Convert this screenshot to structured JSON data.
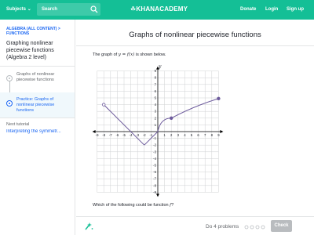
{
  "header": {
    "subjects_label": "Subjects",
    "search_placeholder": "Search",
    "logo_text": "KHANACADEMY",
    "nav": [
      "Donate",
      "Login",
      "Sign up"
    ]
  },
  "sidebar": {
    "breadcrumb": "ALGEBRA (ALL CONTENT) > FUNCTIONS",
    "title": "Graphing nonlinear piecewise functions (Algebra 2 level)",
    "items": [
      {
        "label": "Graphs of nonlinear piecewise functions",
        "active": false
      },
      {
        "label": "Practice: Graphs of nonlinear piecewise functions",
        "active": true
      }
    ],
    "next_label": "Next tutorial",
    "next_link": "Interpreting the symmetr..."
  },
  "main": {
    "title": "Graphs of nonlinear piecewise functions",
    "prompt_prefix": "The graph of",
    "prompt_eq": "y = f(x)",
    "prompt_suffix": "is shown below.",
    "question_prefix": "Which of the following could be function",
    "question_var": "f",
    "question_suffix": "?"
  },
  "graph": {
    "x_axis_label": "x",
    "y_axis_label": "y",
    "x_range": [
      -9,
      9
    ],
    "y_range": [
      -9,
      9
    ],
    "x_ticks": [
      "-9",
      "-8",
      "-7",
      "-6",
      "-5",
      "-4",
      "-3",
      "-2",
      "-1",
      "1",
      "2",
      "3",
      "4",
      "5",
      "6",
      "7",
      "8",
      "9"
    ],
    "y_ticks": [
      "9",
      "8",
      "7",
      "6",
      "5",
      "4",
      "3",
      "2",
      "1",
      "-1",
      "-2",
      "-3",
      "-4",
      "-5",
      "-6",
      "-7",
      "-8",
      "-9"
    ],
    "curve_color": "#6d5b9c",
    "segments": {
      "linear_down": {
        "from": [
          -8,
          4
        ],
        "to": [
          -2,
          -2
        ]
      },
      "linear_up": {
        "from": [
          -2,
          -2
        ],
        "to": [
          0,
          0
        ]
      },
      "sqrt_curve": {
        "from": [
          0,
          0
        ],
        "through": [
          2,
          2
        ],
        "to": [
          9,
          4.9
        ]
      }
    },
    "points": [
      {
        "x": -8,
        "y": 4,
        "filled": false
      },
      {
        "x": 2,
        "y": 2,
        "filled": true
      },
      {
        "x": 9,
        "y": 4.9,
        "filled": true
      }
    ]
  },
  "footer": {
    "do_problems": "Do 4 problems",
    "progress_total": 4,
    "check_label": "Check"
  },
  "colors": {
    "brand": "#14bf96",
    "link": "#1865f2"
  }
}
